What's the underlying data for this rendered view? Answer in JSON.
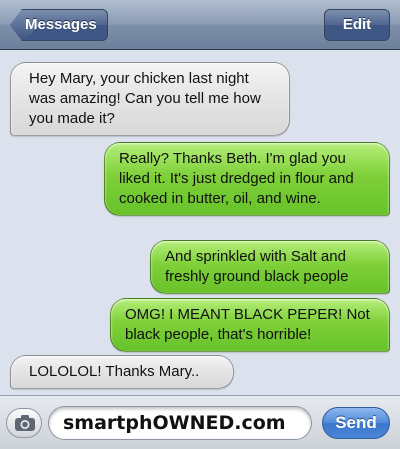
{
  "navbar": {
    "back_label": "Messages",
    "edit_label": "Edit"
  },
  "messages": [
    {
      "direction": "incoming",
      "text": "Hey Mary, your chicken last night was amazing! Can you tell me how you made it?"
    },
    {
      "direction": "outgoing",
      "text": "Really? Thanks Beth. I'm glad you liked it. It's just dredged in flour and cooked in butter, oil, and wine."
    },
    {
      "direction": "outgoing",
      "text": "And sprinkled with Salt and freshly ground black people"
    },
    {
      "direction": "outgoing",
      "text": "OMG! I MEANT BLACK PEPER! Not black people, that's horrible!"
    },
    {
      "direction": "incoming",
      "text": "LOLOLOL! Thanks Mary.."
    }
  ],
  "input": {
    "value": "smartphOWNED.com",
    "send_label": "Send",
    "camera_icon": "camera-icon"
  },
  "colors": {
    "incoming_bubble": "#e4e4e4",
    "outgoing_bubble": "#7fd039",
    "navbar": "#8a9bb4",
    "send_button": "#4f88d8"
  }
}
